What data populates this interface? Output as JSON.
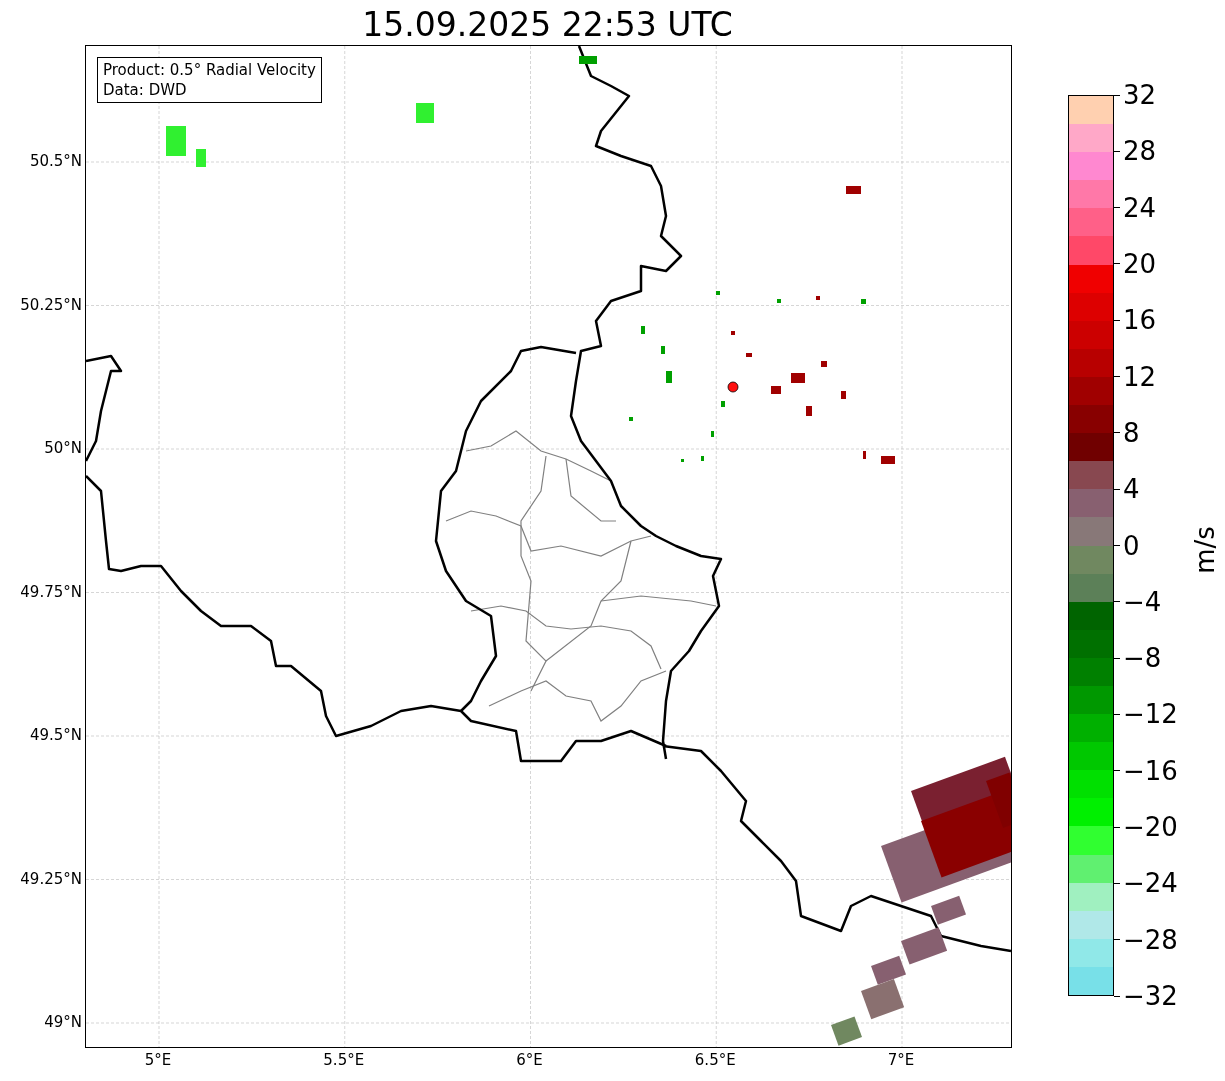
{
  "title": "15.09.2025 22:53 UTC",
  "legend": [
    "Product: 0.5° Radial Velocity",
    "Data: DWD"
  ],
  "map": {
    "yticks": [
      "50.5°N",
      "50.25°N",
      "50°N",
      "49.75°N",
      "49.5°N",
      "49.25°N",
      "49°N"
    ],
    "xticks": [
      "5°E",
      "5.5°E",
      "6°E",
      "6.5°E",
      "7°E"
    ]
  },
  "colorbar": {
    "label": "m/s",
    "ticks": [
      "32",
      "28",
      "24",
      "20",
      "16",
      "12",
      "8",
      "4",
      "0",
      "−4",
      "−8",
      "−12",
      "−16",
      "−20",
      "−24",
      "−28",
      "−32"
    ],
    "segments": [
      {
        "color": "#ffd0b0"
      },
      {
        "color": "#ffa8c8"
      },
      {
        "color": "#ff88d0"
      },
      {
        "color": "#ff78a8"
      },
      {
        "color": "#ff6088"
      },
      {
        "color": "#ff4868"
      },
      {
        "color": "#f00000"
      },
      {
        "color": "#dd0000"
      },
      {
        "color": "#cc0000"
      },
      {
        "color": "#b80000"
      },
      {
        "color": "#a00000"
      },
      {
        "color": "#880000"
      },
      {
        "color": "#700000"
      },
      {
        "color": "#884850"
      },
      {
        "color": "#886070"
      },
      {
        "color": "#887878"
      },
      {
        "color": "#708860"
      },
      {
        "color": "#5c8058"
      },
      {
        "color": "#006400"
      },
      {
        "color": "#007000"
      },
      {
        "color": "#008000"
      },
      {
        "color": "#009800"
      },
      {
        "color": "#00b000"
      },
      {
        "color": "#00c800"
      },
      {
        "color": "#00e000"
      },
      {
        "color": "#00f000"
      },
      {
        "color": "#30ff30"
      },
      {
        "color": "#60f070"
      },
      {
        "color": "#a0f0c0"
      },
      {
        "color": "#b0e8e8"
      },
      {
        "color": "#90e8e8"
      },
      {
        "color": "#78e0e8"
      }
    ]
  }
}
